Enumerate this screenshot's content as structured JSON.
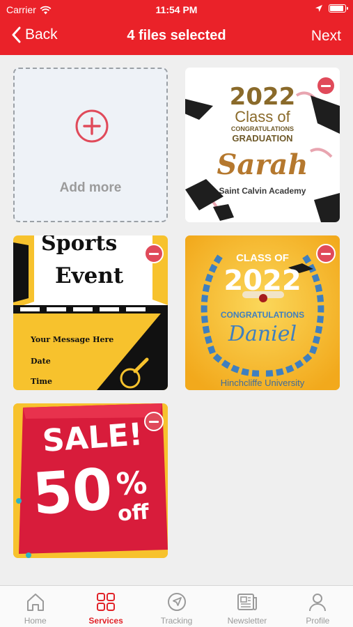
{
  "status_bar": {
    "carrier": "Carrier",
    "time": "11:54 PM"
  },
  "nav": {
    "back_label": "Back",
    "title": "4 files selected",
    "next_label": "Next"
  },
  "grid": {
    "add_more_label": "Add more",
    "cards": [
      {
        "top_line": "2022",
        "line2": "Class of",
        "line3": "CONGRATULATIONS",
        "line4": "GRADUATION",
        "name": "Sarah",
        "org": "Saint Calvin Academy"
      },
      {
        "line1": "Sports",
        "line2": "Event",
        "message": "Your Message Here",
        "date": "Date",
        "time": "Time"
      },
      {
        "line1": "CLASS OF",
        "year": "2022",
        "line3": "CONGRATULATIONS",
        "name": "Daniel",
        "org": "Hinchcliffe University"
      },
      {
        "line1": "SALE!",
        "line2": "50",
        "percent": "%",
        "off": "off"
      }
    ]
  },
  "tabbar": {
    "tabs": [
      {
        "label": "Home",
        "icon": "home-icon"
      },
      {
        "label": "Services",
        "icon": "grid-icon"
      },
      {
        "label": "Tracking",
        "icon": "navigation-icon"
      },
      {
        "label": "Newsletter",
        "icon": "newspaper-icon"
      },
      {
        "label": "Profile",
        "icon": "user-icon"
      }
    ],
    "active_index": 1
  },
  "colors": {
    "brand": "#ea2229",
    "remove_badge": "#e04a5a",
    "tab_active": "#e12228",
    "tab_inactive": "#9a9a9a"
  }
}
